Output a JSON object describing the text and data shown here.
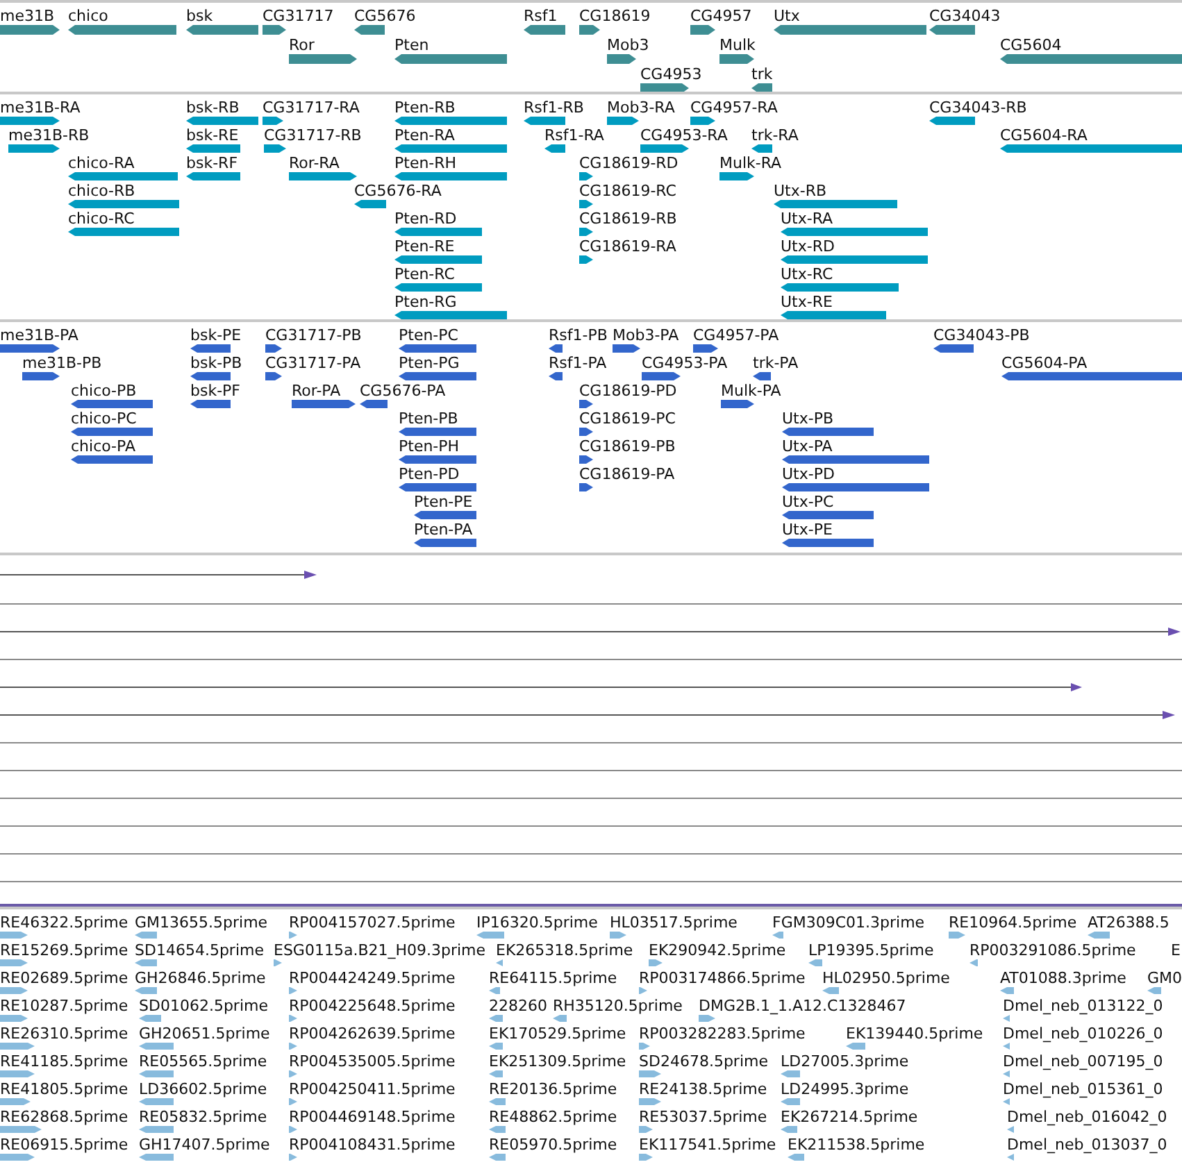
{
  "tracks": [
    {
      "kind": "gene",
      "features": [
        {
          "label": "me31B",
          "reverse": false
        },
        {
          "label": "chico",
          "reverse": true
        },
        {
          "label": "bsk",
          "reverse": true
        },
        {
          "label": "CG31717",
          "reverse": false
        },
        {
          "label": "CG5676",
          "reverse": true
        },
        {
          "label": "Rsf1",
          "reverse": true
        },
        {
          "label": "CG18619",
          "reverse": false
        },
        {
          "label": "CG4957",
          "reverse": false
        },
        {
          "label": "Utx",
          "reverse": true
        },
        {
          "label": "CG34043",
          "reverse": true
        },
        {
          "label": "Ror",
          "reverse": false
        },
        {
          "label": "Pten",
          "reverse": true
        },
        {
          "label": "Mob3",
          "reverse": false
        },
        {
          "label": "Mulk",
          "reverse": false
        },
        {
          "label": "CG5604",
          "reverse": true
        },
        {
          "label": "CG4953",
          "reverse": false
        },
        {
          "label": "trk",
          "reverse": true
        }
      ]
    },
    {
      "kind": "transcript",
      "features": [
        {
          "label": "me31B-RA",
          "reverse": false
        },
        {
          "label": "bsk-RB",
          "reverse": true
        },
        {
          "label": "CG31717-RA",
          "reverse": false
        },
        {
          "label": "Pten-RB",
          "reverse": true
        },
        {
          "label": "Rsf1-RB",
          "reverse": true
        },
        {
          "label": "Mob3-RA",
          "reverse": false
        },
        {
          "label": "CG4957-RA",
          "reverse": false
        },
        {
          "label": "CG34043-RB",
          "reverse": true
        },
        {
          "label": "me31B-RB",
          "reverse": false
        },
        {
          "label": "bsk-RE",
          "reverse": true
        },
        {
          "label": "CG31717-RB",
          "reverse": false
        },
        {
          "label": "Pten-RA",
          "reverse": true
        },
        {
          "label": "Rsf1-RA",
          "reverse": true
        },
        {
          "label": "CG4953-RA",
          "reverse": false
        },
        {
          "label": "trk-RA",
          "reverse": true
        },
        {
          "label": "CG5604-RA",
          "reverse": true
        },
        {
          "label": "chico-RA",
          "reverse": true
        },
        {
          "label": "bsk-RF",
          "reverse": true
        },
        {
          "label": "Ror-RA",
          "reverse": false
        },
        {
          "label": "Pten-RH",
          "reverse": true
        },
        {
          "label": "CG18619-RD",
          "reverse": false
        },
        {
          "label": "Mulk-RA",
          "reverse": false
        },
        {
          "label": "chico-RB",
          "reverse": true
        },
        {
          "label": "CG5676-RA",
          "reverse": true
        },
        {
          "label": "CG18619-RC",
          "reverse": false
        },
        {
          "label": "Utx-RB",
          "reverse": true
        },
        {
          "label": "chico-RC",
          "reverse": true
        },
        {
          "label": "Pten-RD",
          "reverse": true
        },
        {
          "label": "CG18619-RB",
          "reverse": false
        },
        {
          "label": "Utx-RA",
          "reverse": true
        },
        {
          "label": "Pten-RE",
          "reverse": true
        },
        {
          "label": "CG18619-RA",
          "reverse": false
        },
        {
          "label": "Utx-RD",
          "reverse": true
        },
        {
          "label": "Pten-RC",
          "reverse": true
        },
        {
          "label": "Utx-RC",
          "reverse": true
        },
        {
          "label": "Pten-RG",
          "reverse": true
        },
        {
          "label": "Utx-RE",
          "reverse": true
        }
      ]
    },
    {
      "kind": "protein",
      "features": [
        {
          "label": "me31B-PA",
          "reverse": false
        },
        {
          "label": "bsk-PE",
          "reverse": true
        },
        {
          "label": "CG31717-PB",
          "reverse": false
        },
        {
          "label": "Pten-PC",
          "reverse": true
        },
        {
          "label": "Rsf1-PB",
          "reverse": true
        },
        {
          "label": "Mob3-PA",
          "reverse": false
        },
        {
          "label": "CG4957-PA",
          "reverse": false
        },
        {
          "label": "CG34043-PB",
          "reverse": true
        },
        {
          "label": "me31B-PB",
          "reverse": false
        },
        {
          "label": "bsk-PB",
          "reverse": true
        },
        {
          "label": "CG31717-PA",
          "reverse": false
        },
        {
          "label": "Pten-PG",
          "reverse": true
        },
        {
          "label": "Rsf1-PA",
          "reverse": true
        },
        {
          "label": "CG4953-PA",
          "reverse": false
        },
        {
          "label": "trk-PA",
          "reverse": true
        },
        {
          "label": "CG5604-PA",
          "reverse": true
        },
        {
          "label": "chico-PB",
          "reverse": true
        },
        {
          "label": "bsk-PF",
          "reverse": true
        },
        {
          "label": "Ror-PA",
          "reverse": false
        },
        {
          "label": "CG5676-PA",
          "reverse": true
        },
        {
          "label": "CG18619-PD",
          "reverse": false
        },
        {
          "label": "Mulk-PA",
          "reverse": false
        },
        {
          "label": "chico-PC",
          "reverse": true
        },
        {
          "label": "Pten-PB",
          "reverse": true
        },
        {
          "label": "CG18619-PC",
          "reverse": false
        },
        {
          "label": "Utx-PB",
          "reverse": true
        },
        {
          "label": "chico-PA",
          "reverse": true
        },
        {
          "label": "Pten-PH",
          "reverse": true
        },
        {
          "label": "CG18619-PB",
          "reverse": false
        },
        {
          "label": "Utx-PA",
          "reverse": true
        },
        {
          "label": "Pten-PD",
          "reverse": true
        },
        {
          "label": "CG18619-PA",
          "reverse": false
        },
        {
          "label": "Utx-PD",
          "reverse": true
        },
        {
          "label": "Pten-PE",
          "reverse": true
        },
        {
          "label": "Utx-PC",
          "reverse": true
        },
        {
          "label": "Pten-PA",
          "reverse": true
        },
        {
          "label": "Utx-PE",
          "reverse": true
        }
      ]
    },
    {
      "kind": "est",
      "features": [
        {
          "label": "RE46322.5prime",
          "reverse": false
        },
        {
          "label": "GM13655.5prime",
          "reverse": true
        },
        {
          "label": "RP004157027.5prime",
          "reverse": false
        },
        {
          "label": "IP16320.5prime",
          "reverse": true
        },
        {
          "label": "HL03517.5prime",
          "reverse": false
        },
        {
          "label": "FGM309C01.3prime",
          "reverse": true
        },
        {
          "label": "RE10964.5prime",
          "reverse": false
        },
        {
          "label": "AT26388.5",
          "reverse": true
        },
        {
          "label": "RE15269.5prime",
          "reverse": false
        },
        {
          "label": "SD14654.5prime",
          "reverse": true
        },
        {
          "label": "ESG0115a.B21_H09.3prime",
          "reverse": false
        },
        {
          "label": "EK265318.5prime",
          "reverse": true
        },
        {
          "label": "EK290942.5prime",
          "reverse": false
        },
        {
          "label": "LP19395.5prime",
          "reverse": true
        },
        {
          "label": "RP003291086.5prime",
          "reverse": true
        },
        {
          "label": "E"
        },
        {
          "label": "RE02689.5prime",
          "reverse": false
        },
        {
          "label": "GH26846.5prime",
          "reverse": true
        },
        {
          "label": "RP004424249.5prime",
          "reverse": false
        },
        {
          "label": "RE64115.5prime",
          "reverse": true
        },
        {
          "label": "RP003174866.5prime",
          "reverse": false
        },
        {
          "label": "HL02950.5prime",
          "reverse": true
        },
        {
          "label": "AT01088.3prime",
          "reverse": true
        },
        {
          "label": "GM0",
          "reverse": true
        },
        {
          "label": "RE10287.5prime",
          "reverse": false
        },
        {
          "label": "SD01062.5prime",
          "reverse": true
        },
        {
          "label": "RP004225648.5prime",
          "reverse": false
        },
        {
          "label": "228260",
          "reverse": true
        },
        {
          "label": "RH35120.5prime",
          "reverse": true
        },
        {
          "label": "DMG2B.1_1.A12.C1328467",
          "reverse": false
        },
        {
          "label": "Dmel_neb_013122_0",
          "reverse": true
        },
        {
          "label": "RE26310.5prime",
          "reverse": false
        },
        {
          "label": "GH20651.5prime",
          "reverse": true
        },
        {
          "label": "RP004262639.5prime",
          "reverse": false
        },
        {
          "label": "EK170529.5prime",
          "reverse": true
        },
        {
          "label": "RP003282283.5prime",
          "reverse": false
        },
        {
          "label": "EK139440.5prime",
          "reverse": true
        },
        {
          "label": "Dmel_neb_010226_0",
          "reverse": true
        },
        {
          "label": "RE41185.5prime",
          "reverse": false
        },
        {
          "label": "RE05565.5prime",
          "reverse": true
        },
        {
          "label": "RP004535005.5prime",
          "reverse": false
        },
        {
          "label": "EK251309.5prime",
          "reverse": true
        },
        {
          "label": "SD24678.5prime",
          "reverse": false
        },
        {
          "label": "LD27005.3prime",
          "reverse": true
        },
        {
          "label": "Dmel_neb_007195_0",
          "reverse": true
        },
        {
          "label": "RE41805.5prime",
          "reverse": false
        },
        {
          "label": "LD36602.5prime",
          "reverse": true
        },
        {
          "label": "RP004250411.5prime",
          "reverse": false
        },
        {
          "label": "RE20136.5prime",
          "reverse": true
        },
        {
          "label": "RE24138.5prime",
          "reverse": false
        },
        {
          "label": "LD24995.3prime",
          "reverse": true
        },
        {
          "label": "Dmel_neb_015361_0",
          "reverse": true
        },
        {
          "label": "RE62868.5prime",
          "reverse": false
        },
        {
          "label": "RE05832.5prime",
          "reverse": true
        },
        {
          "label": "RP004469148.5prime",
          "reverse": false
        },
        {
          "label": "RE48862.5prime",
          "reverse": true
        },
        {
          "label": "RE53037.5prime",
          "reverse": false
        },
        {
          "label": "EK267214.5prime",
          "reverse": true
        },
        {
          "label": "Dmel_neb_016042_0",
          "reverse": true
        },
        {
          "label": "RE06915.5prime",
          "reverse": false
        },
        {
          "label": "GH17407.5prime",
          "reverse": true
        },
        {
          "label": "RP004108431.5prime",
          "reverse": false
        },
        {
          "label": "RE05970.5prime",
          "reverse": true
        },
        {
          "label": "EK117541.5prime",
          "reverse": false
        },
        {
          "label": "EK211538.5prime",
          "reverse": true
        },
        {
          "label": "Dmel_neb_013037_0",
          "reverse": true
        }
      ]
    }
  ]
}
